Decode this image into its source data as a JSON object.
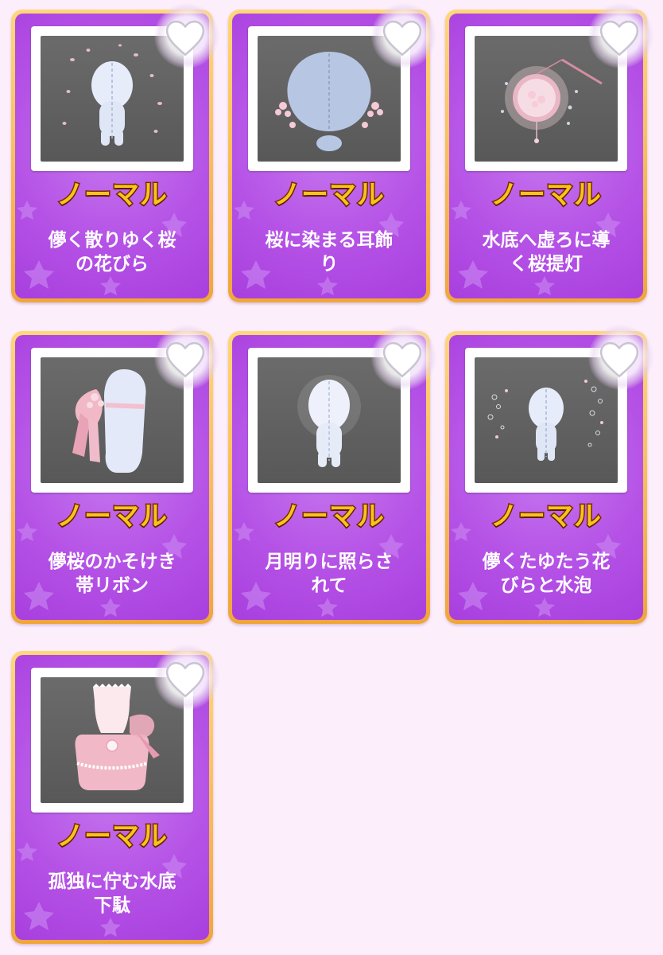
{
  "items": [
    {
      "rarity": "ノーマル",
      "name_line1": "儚く散りゆく桜",
      "name_line2": "の花びら",
      "image": "ghost-with-falling-petals"
    },
    {
      "rarity": "ノーマル",
      "name_line1": "桜に染まる耳飾",
      "name_line2": "り",
      "image": "ghost-with-sakura-earrings"
    },
    {
      "rarity": "ノーマル",
      "name_line1": "水底へ虚ろに導",
      "name_line2": "く桜提灯",
      "image": "sakura-lantern"
    },
    {
      "rarity": "ノーマル",
      "name_line1": "儚桜のかそけき",
      "name_line2": "帯リボン",
      "image": "ghost-with-sash-ribbon"
    },
    {
      "rarity": "ノーマル",
      "name_line1": "月明りに照らさ",
      "name_line2": "れて",
      "image": "glowing-ghost"
    },
    {
      "rarity": "ノーマル",
      "name_line1": "儚くたゆたう花",
      "name_line2": "びらと水泡",
      "image": "ghost-with-bubbles"
    },
    {
      "rarity": "ノーマル",
      "name_line1": "孤独に佇む水底",
      "name_line2": "下駄",
      "image": "pink-sock-shoes"
    }
  ],
  "colors": {
    "background": "#fdeefb",
    "card_border": "#f0a63a",
    "card_fill": "#b552e6",
    "rarity_text": "#f7c31c",
    "photo_bg": "#626262"
  },
  "icons": {
    "favorite": "heart-icon"
  }
}
